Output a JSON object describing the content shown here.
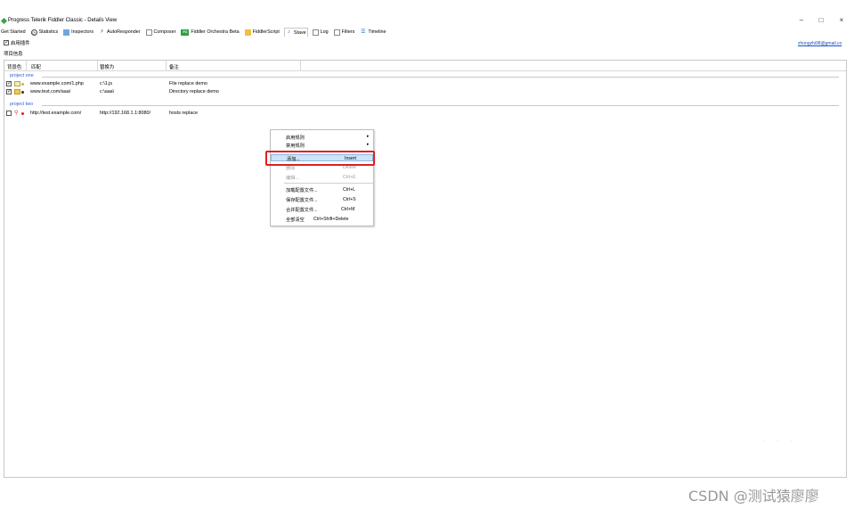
{
  "window": {
    "title": "Progress Telerik Fiddler Classic - Details View",
    "min_glyph": "–",
    "max_glyph": "□",
    "close_glyph": "×"
  },
  "tabs": [
    {
      "label": "Get Started",
      "icon": ""
    },
    {
      "label": "Statistics",
      "icon": "statistics-icon"
    },
    {
      "label": "Inspectors",
      "icon": "inspectors-icon"
    },
    {
      "label": "AutoResponder",
      "icon": "autoresponder-icon"
    },
    {
      "label": "Composer",
      "icon": "composer-icon"
    },
    {
      "label": "Fiddler Orchestra Beta",
      "icon": "orchestra-icon"
    },
    {
      "label": "FiddlerScript",
      "icon": "fiddlerscript-icon"
    },
    {
      "label": "Stave",
      "icon": "stave-icon"
    },
    {
      "label": "Log",
      "icon": "log-icon"
    },
    {
      "label": "Filters",
      "icon": "filters-icon"
    },
    {
      "label": "Timeline",
      "icon": "timeline-icon"
    }
  ],
  "plugin": {
    "enable_label": "启用插件",
    "enabled": true,
    "email": "zhongzhi98@gmail.co",
    "section_label": "项目信息"
  },
  "grid": {
    "columns": [
      "背景色",
      "匹配",
      "替换为",
      "备注"
    ],
    "groups": [
      {
        "name": "project one",
        "rows": [
          {
            "checked": true,
            "match": "www.example.com/1.php",
            "replace": "c:\\1.js",
            "note": "File replace demo"
          },
          {
            "checked": true,
            "match": "www.test.com/aaa/",
            "replace": "c:\\aaa\\",
            "note": "Directory replace demo"
          }
        ]
      },
      {
        "name": "project two",
        "rows": [
          {
            "checked": false,
            "match": "http://test.example.com/",
            "replace": "http://192.168.1.1:8080/",
            "note": "hosts replace"
          }
        ]
      }
    ]
  },
  "context_menu": {
    "items": [
      {
        "label": "启用规则",
        "shortcut": "",
        "submenu": true,
        "disabled": false
      },
      {
        "label": "禁用规则",
        "shortcut": "",
        "submenu": true,
        "disabled": false
      },
      {
        "label": "添加...",
        "shortcut": "Insert",
        "submenu": false,
        "disabled": false,
        "highlighted": true
      },
      {
        "label": "删除",
        "shortcut": "Delete",
        "submenu": false,
        "disabled": true
      },
      {
        "label": "编辑...",
        "shortcut": "Ctrl+E",
        "submenu": false,
        "disabled": true
      },
      {
        "label": "加载配置文件...",
        "shortcut": "Ctrl+L",
        "submenu": false,
        "disabled": false
      },
      {
        "label": "保存配置文件...",
        "shortcut": "Ctrl+S",
        "submenu": false,
        "disabled": false
      },
      {
        "label": "合并配置文件...",
        "shortcut": "Ctrl+M",
        "submenu": false,
        "disabled": false
      },
      {
        "label": "全部清空",
        "shortcut": "Ctrl+Shift+Delete",
        "submenu": false,
        "disabled": false
      }
    ],
    "submenu_arrow": "▸"
  },
  "watermark": "CSDN @测试猿廖廖",
  "colors": {
    "group_label": "#2b5fd9",
    "highlight_border": "#e02020",
    "menu_highlight": "#cde3f7"
  }
}
